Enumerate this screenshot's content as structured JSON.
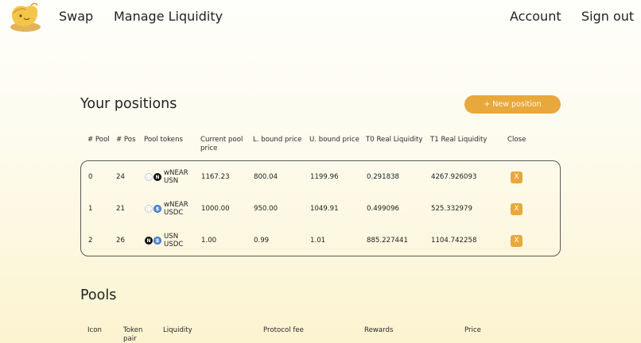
{
  "nav": {
    "swap": "Swap",
    "manage_liquidity": "Manage Liquidity",
    "account": "Account",
    "sign_out": "Sign out"
  },
  "positions": {
    "title": "Your positions",
    "new_button": "+ New position",
    "headers": {
      "pool": "# Pool",
      "pos": "# Pos",
      "pool_tokens": "Pool tokens",
      "current_price_1": "Current pool",
      "current_price_2": "price",
      "lower": "L. bound price",
      "upper": "U. bound price",
      "t0": "T0 Real Liquidity",
      "t1": "T1 Real Liquidity",
      "close": "Close"
    },
    "rows": [
      {
        "pool": "0",
        "pos": "24",
        "token0": "wNEAR",
        "token1": "USN",
        "icon0": "wnear-icon",
        "icon1": "usn-icon",
        "current_price": "1167.23",
        "lower": "800.04",
        "upper": "1199.96",
        "t0": "0.291838",
        "t1": "4267.926093",
        "close": "X"
      },
      {
        "pool": "1",
        "pos": "21",
        "token0": "wNEAR",
        "token1": "USDC",
        "icon0": "wnear-icon",
        "icon1": "usdc-icon",
        "current_price": "1000.00",
        "lower": "950.00",
        "upper": "1049.91",
        "t0": "0.499096",
        "t1": "525.332979",
        "close": "X"
      },
      {
        "pool": "2",
        "pos": "26",
        "token0": "USN",
        "token1": "USDC",
        "icon0": "usn-icon",
        "icon1": "usdc-icon",
        "current_price": "1.00",
        "lower": "0.99",
        "upper": "1.01",
        "t0": "885.227441",
        "t1": "1104.742258",
        "close": "X"
      }
    ]
  },
  "pools": {
    "title": "Pools",
    "headers": {
      "icon": "Icon",
      "pair_1": "Token",
      "pair_2": "pair",
      "liquidity": "Liquidity",
      "protocol_fee": "Protocol fee",
      "rewards": "Rewards",
      "price": "Price"
    }
  },
  "colors": {
    "accent": "#e8a83b",
    "text": "#222222",
    "border": "#5a5a5a"
  }
}
